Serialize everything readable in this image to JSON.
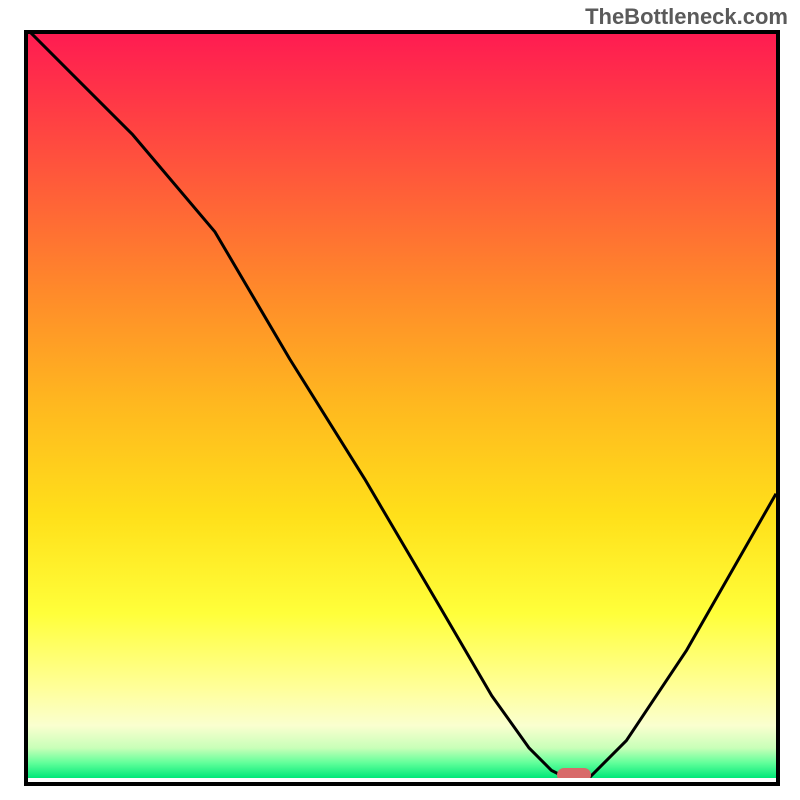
{
  "watermark": "TheBottleneck.com",
  "chart_data": {
    "type": "line",
    "title": "",
    "xlabel": "",
    "ylabel": "",
    "xlim": [
      0,
      100
    ],
    "ylim": [
      0,
      100
    ],
    "series": [
      {
        "name": "bottleneck-curve",
        "x": [
          0,
          6,
          14,
          25,
          35,
          45,
          55,
          62,
          67,
          70,
          72,
          75,
          80,
          88,
          100
        ],
        "values": [
          100,
          94,
          86,
          73,
          56,
          40,
          23,
          11,
          4,
          1,
          0,
          0,
          5,
          17,
          38
        ]
      }
    ],
    "annotations": [
      {
        "type": "marker",
        "x": 73,
        "y": 0,
        "label": "optimal-point"
      }
    ],
    "background": {
      "type": "vertical-gradient",
      "stops": [
        {
          "pos": 0,
          "color": "#ff1a52"
        },
        {
          "pos": 20,
          "color": "#ff5a3a"
        },
        {
          "pos": 50,
          "color": "#ffb81f"
        },
        {
          "pos": 78,
          "color": "#ffff3a"
        },
        {
          "pos": 93,
          "color": "#faffcf"
        },
        {
          "pos": 100,
          "color": "#00e878"
        }
      ]
    }
  },
  "marker_color": "#d86a6a"
}
